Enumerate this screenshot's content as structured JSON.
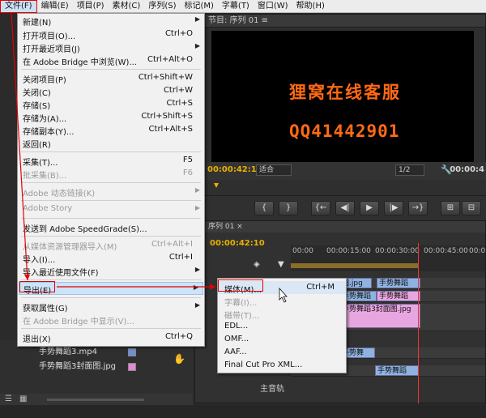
{
  "menubar": {
    "items": [
      "文件(F)",
      "编辑(E)",
      "项目(P)",
      "素材(C)",
      "序列(S)",
      "标记(M)",
      "字幕(T)",
      "窗口(W)",
      "帮助(H)"
    ]
  },
  "monitor": {
    "tab_label": "节目: 序列 01 ≡",
    "overlay_line1": "狸窝在线客服",
    "overlay_line2": "QQ41442901",
    "timecode_left": "00:00:42:10",
    "fit_label": "适合",
    "ratio_label": "1/2",
    "timecode_right": "00:00:4"
  },
  "transport": {
    "buttons": [
      "{",
      "}",
      "{←",
      "◀|",
      "▶",
      "|▶",
      "→}",
      "⊞",
      "⊟"
    ]
  },
  "timeline": {
    "tab_label": "序列 01 ×",
    "timecode": "00:00:42:10",
    "ruler_ticks": [
      "00:00",
      "00:00:15:00",
      "00:00:30:00",
      "00:00:45:00",
      "00:01"
    ],
    "clips": {
      "c1": "图.jpg",
      "c2": "手势舞蹈",
      "c3": "手势舞蹈",
      "c4": "手势舞蹈",
      "c5": "手势舞蹈3封面图.jpg",
      "c6": "手势舞",
      "c7": "手势舞蹈"
    },
    "main_track": "主音轨"
  },
  "project": {
    "items": [
      {
        "name": "手势舞蹈3.mp4",
        "color": "#6f8fd6"
      },
      {
        "name": "手势舞蹈3封面图.jpg",
        "color": "#e08ad8"
      }
    ]
  },
  "file_menu": {
    "items": [
      {
        "label": "新建(N)",
        "shortcut": "",
        "submenu": true,
        "disabled": false
      },
      {
        "label": "打开项目(O)...",
        "shortcut": "Ctrl+O",
        "submenu": false,
        "disabled": false
      },
      {
        "label": "打开最近项目(J)",
        "shortcut": "",
        "submenu": true,
        "disabled": false
      },
      {
        "label": "在 Adobe Bridge 中浏览(W)...",
        "shortcut": "Ctrl+Alt+O",
        "submenu": false,
        "disabled": false
      },
      {
        "label": "关闭项目(P)",
        "shortcut": "Ctrl+Shift+W",
        "submenu": false,
        "disabled": false
      },
      {
        "label": "关闭(C)",
        "shortcut": "Ctrl+W",
        "submenu": false,
        "disabled": false
      },
      {
        "label": "存储(S)",
        "shortcut": "Ctrl+S",
        "submenu": false,
        "disabled": false
      },
      {
        "label": "存储为(A)...",
        "shortcut": "Ctrl+Shift+S",
        "submenu": false,
        "disabled": false
      },
      {
        "label": "存储副本(Y)...",
        "shortcut": "Ctrl+Alt+S",
        "submenu": false,
        "disabled": false
      },
      {
        "label": "返回(R)",
        "shortcut": "",
        "submenu": false,
        "disabled": false
      },
      {
        "label": "采集(T)...",
        "shortcut": "F5",
        "submenu": false,
        "disabled": false
      },
      {
        "label": "批采集(B)...",
        "shortcut": "F6",
        "submenu": false,
        "disabled": true
      },
      {
        "label": "Adobe 动态链接(K)",
        "shortcut": "",
        "submenu": true,
        "disabled": true
      },
      {
        "label": "Adobe Story",
        "shortcut": "",
        "submenu": true,
        "disabled": true
      },
      {
        "label": "发送到 Adobe SpeedGrade(S)...",
        "shortcut": "",
        "submenu": false,
        "disabled": false
      },
      {
        "label": "从媒体资源管理器导入(M)",
        "shortcut": "Ctrl+Alt+I",
        "submenu": false,
        "disabled": true
      },
      {
        "label": "导入(I)...",
        "shortcut": "Ctrl+I",
        "submenu": false,
        "disabled": false
      },
      {
        "label": "导入最近使用文件(F)",
        "shortcut": "",
        "submenu": true,
        "disabled": false
      },
      {
        "label": "导出(E)",
        "shortcut": "",
        "submenu": true,
        "disabled": false
      },
      {
        "label": "获取属性(G)",
        "shortcut": "",
        "submenu": true,
        "disabled": false
      },
      {
        "label": "在 Adobe Bridge 中显示(V)...",
        "shortcut": "",
        "submenu": false,
        "disabled": true
      },
      {
        "label": "退出(X)",
        "shortcut": "Ctrl+Q",
        "submenu": false,
        "disabled": false
      }
    ]
  },
  "export_menu": {
    "items": [
      {
        "label": "媒体(M)...",
        "shortcut": "Ctrl+M",
        "disabled": false
      },
      {
        "label": "字幕(I)...",
        "shortcut": "",
        "disabled": true
      },
      {
        "label": "磁带(T)...",
        "shortcut": "",
        "disabled": true
      },
      {
        "label": "EDL...",
        "shortcut": "",
        "disabled": false
      },
      {
        "label": "OMF...",
        "shortcut": "",
        "disabled": false
      },
      {
        "label": "AAF...",
        "shortcut": "",
        "disabled": false
      },
      {
        "label": "Final Cut Pro XML...",
        "shortcut": "",
        "disabled": false
      }
    ]
  },
  "colors": {
    "annotation_red": "#e60000",
    "overlay_orange": "#ff6a13",
    "timecode_yellow": "#e8b000"
  }
}
